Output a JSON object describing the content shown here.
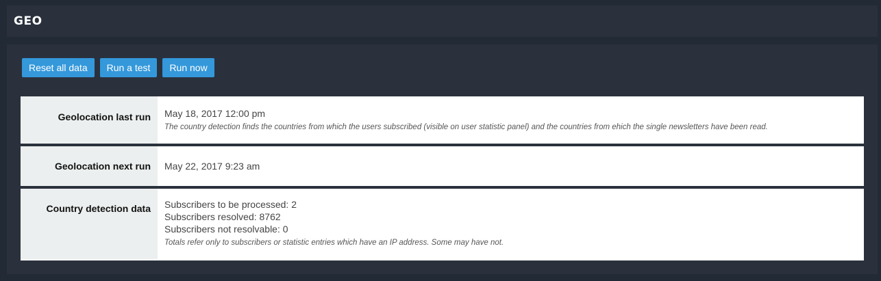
{
  "header": {
    "title": "GEO"
  },
  "toolbar": {
    "buttons": [
      {
        "label": "Reset all data"
      },
      {
        "label": "Run a test"
      },
      {
        "label": "Run now"
      }
    ]
  },
  "rows": {
    "last_run": {
      "label": "Geolocation last run",
      "value": "May 18, 2017 12:00 pm",
      "note": "The country detection finds the countries from which the users subscribed (visible on user statistic panel) and the countries from ehich the single newsletters have been read."
    },
    "next_run": {
      "label": "Geolocation next run",
      "value": "May 22, 2017 9:23 am"
    },
    "country_data": {
      "label": "Country detection data",
      "lines": [
        "Subscribers to be processed: 2",
        "Subscribers resolved: 8762",
        "Subscribers not resolvable: 0"
      ],
      "note": "Totals refer only to subscribers or statistic entries which have an IP address. Some may have not."
    }
  },
  "colors": {
    "page_bg": "#222a35",
    "panel_bg": "#2a313d",
    "button_bg": "#3498db",
    "label_cell_bg": "#ecefef"
  }
}
